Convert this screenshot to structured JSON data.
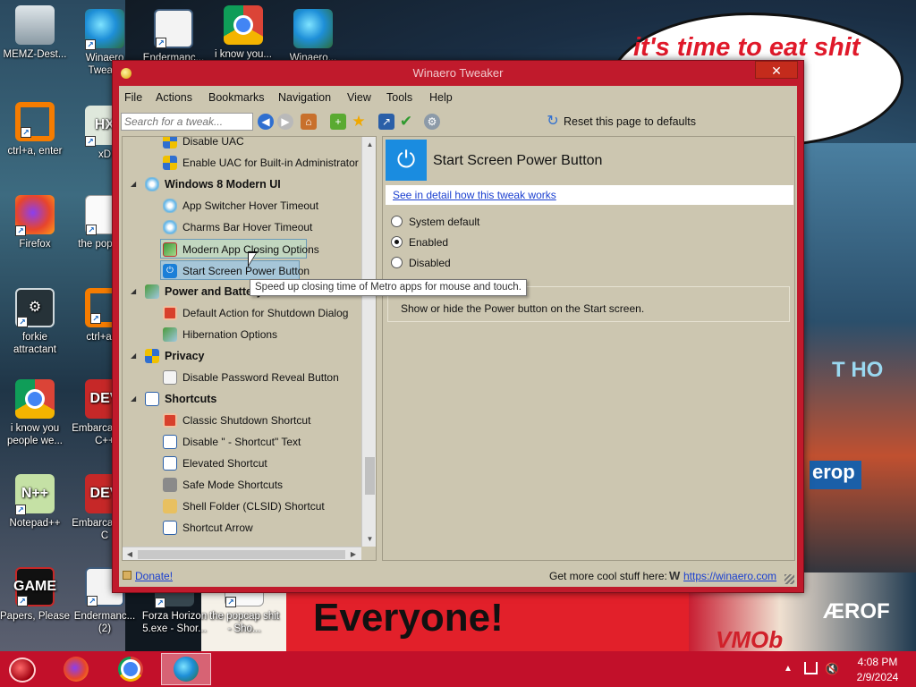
{
  "desktop": {
    "bubble_text": "it's time to eat shit celebrate",
    "banner_text": "Everyone!",
    "icons": [
      {
        "label": "MEMZ-Dest..."
      },
      {
        "label": "Winaero Twea..."
      },
      {
        "label": "Endermanc..."
      },
      {
        "label": "i know you..."
      },
      {
        "label": "Winaero..."
      },
      {
        "label": "ctrl+a, enter"
      },
      {
        "label": "xD"
      },
      {
        "label": "Firefox"
      },
      {
        "label": "the pop shit"
      },
      {
        "label": "forkie attractant"
      },
      {
        "label": "ctrl+a, e"
      },
      {
        "label": "i know you people we..."
      },
      {
        "label": "Embarca Dev-C++"
      },
      {
        "label": "Notepad++"
      },
      {
        "label": "Embarca Dev-C"
      },
      {
        "label": "Papers, Please"
      },
      {
        "label": "Endermanc... (2)"
      },
      {
        "label": "Forza Horizon 5.exe - Shor..."
      },
      {
        "label": "the popcap shit - Sho..."
      }
    ]
  },
  "window": {
    "title": "Winaero Tweaker",
    "close_label": "✕",
    "menu": [
      "File",
      "Actions",
      "Bookmarks",
      "Navigation",
      "View",
      "Tools",
      "Help"
    ],
    "search_placeholder": "Search for a tweak...",
    "reset_label": "Reset this page to defaults",
    "tree": [
      {
        "label": "Disable UAC",
        "type": "item"
      },
      {
        "label": "Enable UAC for Built-in Administrator",
        "type": "item"
      },
      {
        "label": "Windows 8 Modern UI",
        "type": "category"
      },
      {
        "label": "App Switcher Hover Timeout",
        "type": "item"
      },
      {
        "label": "Charms Bar Hover Timeout",
        "type": "item"
      },
      {
        "label": "Modern App Closing Options",
        "type": "item",
        "state": "hover"
      },
      {
        "label": "Start Screen Power Button",
        "type": "item",
        "state": "selected"
      },
      {
        "label": "Power and Battery",
        "type": "category"
      },
      {
        "label": "Default Action for Shutdown Dialog",
        "type": "item"
      },
      {
        "label": "Hibernation Options",
        "type": "item"
      },
      {
        "label": "Privacy",
        "type": "category"
      },
      {
        "label": "Disable Password Reveal Button",
        "type": "item"
      },
      {
        "label": "Shortcuts",
        "type": "category"
      },
      {
        "label": "Classic Shutdown Shortcut",
        "type": "item"
      },
      {
        "label": "Disable \" - Shortcut\" Text",
        "type": "item"
      },
      {
        "label": "Elevated Shortcut",
        "type": "item"
      },
      {
        "label": "Safe Mode Shortcuts",
        "type": "item"
      },
      {
        "label": "Shell Folder (CLSID) Shortcut",
        "type": "item"
      },
      {
        "label": "Shortcut Arrow",
        "type": "item"
      }
    ],
    "tooltip": "Speed up closing time of Metro apps for mouse and touch.",
    "detail": {
      "title": "Start Screen Power Button",
      "link": "See in detail how this tweak works",
      "options": [
        {
          "label": "System default",
          "checked": false
        },
        {
          "label": "Enabled",
          "checked": true
        },
        {
          "label": "Disabled",
          "checked": false
        }
      ],
      "description": "Show or hide the Power button on the Start screen."
    },
    "status": {
      "donate": "Donate!",
      "get_more": "Get more cool stuff here:",
      "logo": "W",
      "site": "https://winaero.com"
    }
  },
  "taskbar": {
    "time": "4:08 PM",
    "date": "2/9/2024"
  }
}
